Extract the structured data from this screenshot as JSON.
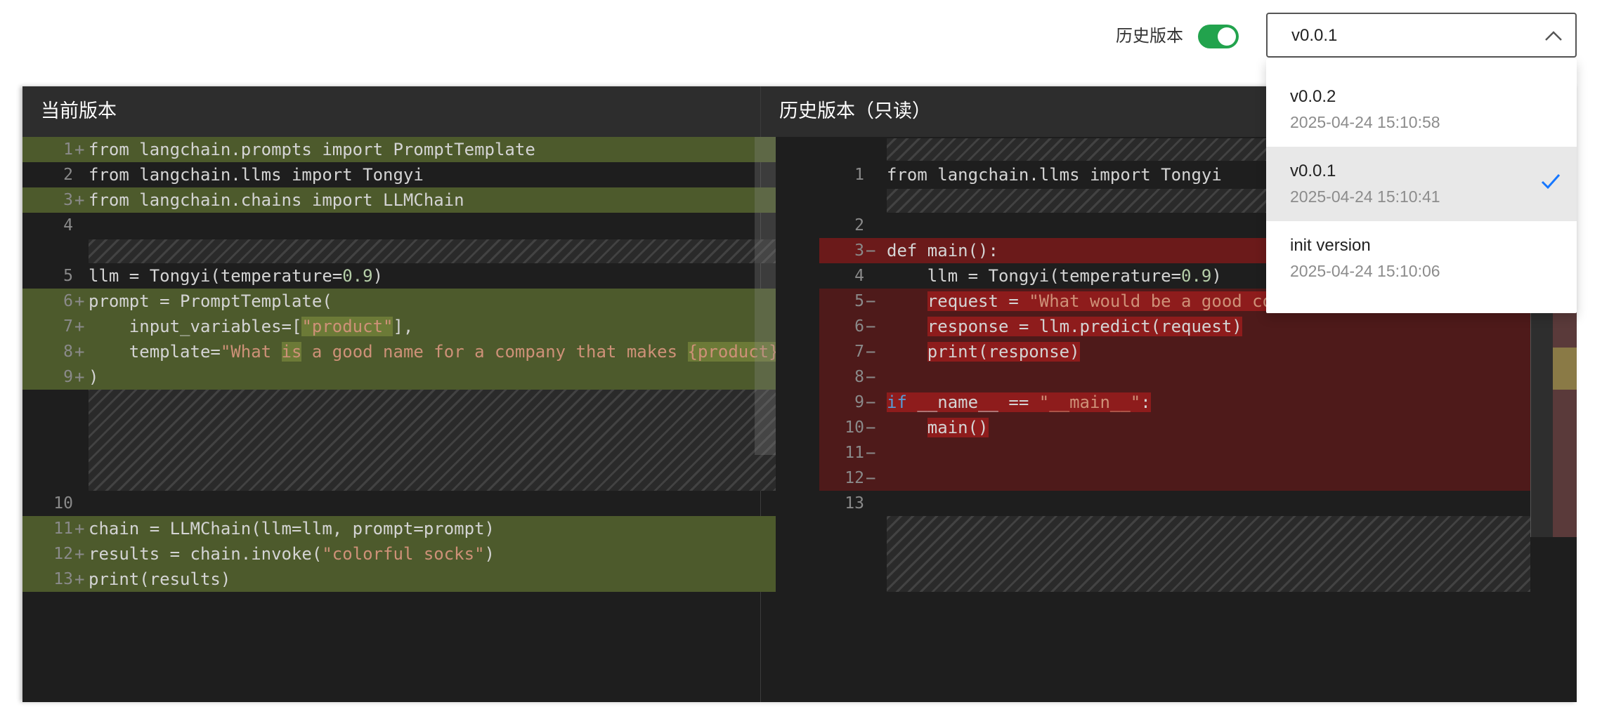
{
  "toolbar": {
    "history_label": "历史版本",
    "history_enabled": true,
    "selected_version": "v0.0.1"
  },
  "colors": {
    "toggle_on": "#22a34d",
    "added_bg": "#4d5a2c",
    "removed_bg": "#6b1a1a",
    "check": "#1677ff"
  },
  "left": {
    "title": "当前版本",
    "lines": [
      {
        "num": "1",
        "mark": "+",
        "text": "from langchain.prompts import PromptTemplate"
      },
      {
        "num": "2",
        "mark": "",
        "text": "from langchain.llms import Tongyi"
      },
      {
        "num": "3",
        "mark": "+",
        "text": "from langchain.chains import LLMChain"
      },
      {
        "num": "4",
        "mark": "",
        "text": ""
      },
      {
        "num": "5",
        "mark": "",
        "text_a": "llm = Tongyi(temperature=",
        "text_b": "0.9",
        "text_c": ")"
      },
      {
        "num": "6",
        "mark": "+",
        "text": "prompt = PromptTemplate("
      },
      {
        "num": "7",
        "mark": "+",
        "text_a": "    input_variables=[",
        "text_b": "\"product\"",
        "text_c": "],"
      },
      {
        "num": "8",
        "mark": "+",
        "text_a": "    template=",
        "text_b": "\"What ",
        "text_c": "is",
        "text_d": " a good name for a company that makes ",
        "text_e": "{product}"
      },
      {
        "num": "9",
        "mark": "+",
        "text": ")"
      },
      {
        "num": "10",
        "mark": "",
        "text": ""
      },
      {
        "num": "11",
        "mark": "+",
        "text": "chain = LLMChain(llm=llm, prompt=prompt)"
      },
      {
        "num": "12",
        "mark": "+",
        "text_a": "results = chain.invoke(",
        "text_b": "\"colorful socks\"",
        "text_c": ")"
      },
      {
        "num": "13",
        "mark": "+",
        "text": "print(results)"
      }
    ]
  },
  "right": {
    "title": "历史版本（只读）",
    "lines": [
      {
        "num": "1",
        "mark": "",
        "text": "from langchain.llms import Tongyi"
      },
      {
        "num": "2",
        "mark": "",
        "text": ""
      },
      {
        "num": "3",
        "mark": "−",
        "text": "def main():"
      },
      {
        "num": "4",
        "mark": "",
        "text_a": "    llm = Tongyi(temperature=",
        "text_b": "0.9",
        "text_c": ")"
      },
      {
        "num": "5",
        "mark": "−",
        "text_a": "    ",
        "text_b": "request = ",
        "text_c": "\"What would be a good co"
      },
      {
        "num": "6",
        "mark": "−",
        "text_a": "    ",
        "text_b": "response = llm.predict(request)"
      },
      {
        "num": "7",
        "mark": "−",
        "text_a": "    ",
        "text_b": "print(response)"
      },
      {
        "num": "8",
        "mark": "−",
        "text": ""
      },
      {
        "num": "9",
        "mark": "−",
        "text_a": "if",
        "text_b": " __name__ == ",
        "text_c": "\"__main__\"",
        "text_d": ":"
      },
      {
        "num": "10",
        "mark": "−",
        "text_a": "    ",
        "text_b": "main()"
      },
      {
        "num": "11",
        "mark": "−",
        "text": ""
      },
      {
        "num": "12",
        "mark": "−",
        "text": ""
      },
      {
        "num": "13",
        "mark": "",
        "text": ""
      }
    ]
  },
  "versions": [
    {
      "name": "v0.0.2",
      "time": "2025-04-24 15:10:58"
    },
    {
      "name": "v0.0.1",
      "time": "2025-04-24 15:10:41",
      "selected": true
    },
    {
      "name": "init version",
      "time": "2025-04-24 15:10:06"
    }
  ]
}
